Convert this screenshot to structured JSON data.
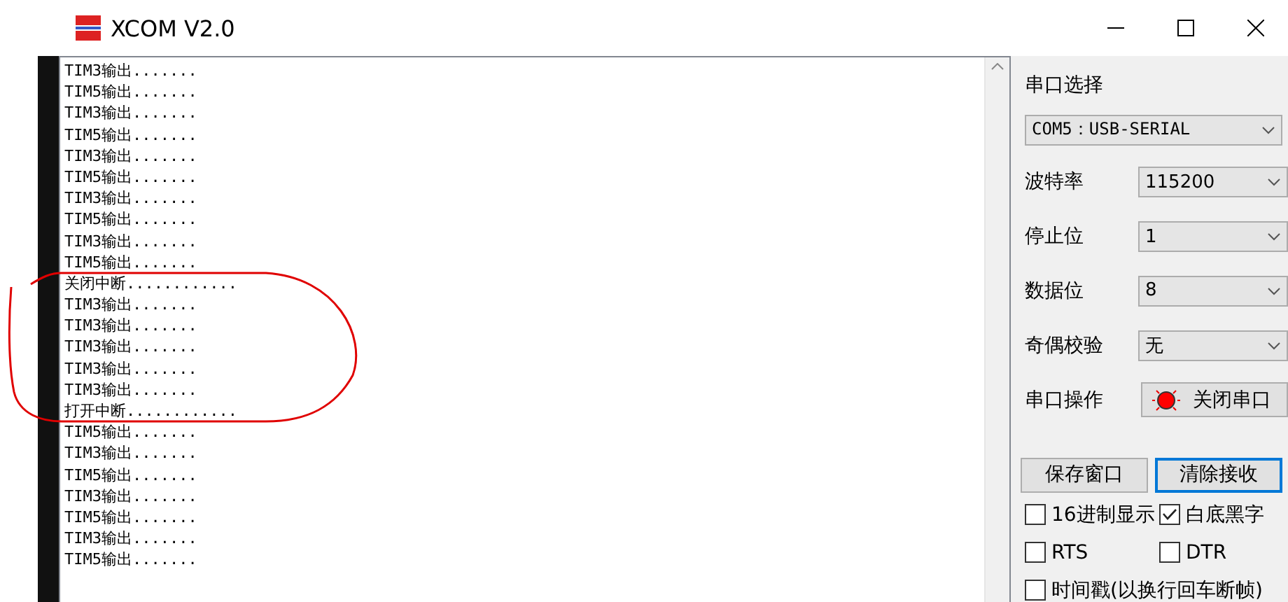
{
  "window": {
    "title": "XCOM V2.0"
  },
  "log_lines": [
    "TIM3输出.......",
    "TIM5输出.......",
    "TIM3输出.......",
    "TIM5输出.......",
    "TIM3输出.......",
    "TIM5输出.......",
    "TIM3输出.......",
    "TIM5输出.......",
    "TIM3输出.......",
    "TIM5输出.......",
    "关闭中断............",
    "TIM3输出.......",
    "TIM3输出.......",
    "TIM3输出.......",
    "TIM3输出.......",
    "TIM3输出.......",
    "打开中断............",
    "TIM5输出.......",
    "TIM3输出.......",
    "TIM5输出.......",
    "TIM3输出.......",
    "TIM5输出.......",
    "TIM3输出.......",
    "TIM5输出......."
  ],
  "port_select": {
    "label": "串口选择",
    "value": "COM5：USB-SERIAL"
  },
  "settings": [
    {
      "label": "波特率",
      "value": "115200"
    },
    {
      "label": "停止位",
      "value": "1"
    },
    {
      "label": "数据位",
      "value": "8"
    },
    {
      "label": "奇偶校验",
      "value": "无"
    }
  ],
  "port_operation": {
    "label": "串口操作",
    "button": "关闭串口",
    "open": true
  },
  "buttons": [
    {
      "label": "保存窗口",
      "focused": false
    },
    {
      "label": "清除接收",
      "focused": true
    }
  ],
  "checkboxes": [
    {
      "label": "16进制显示",
      "checked": false
    },
    {
      "label": "白底黑字",
      "checked": true
    },
    {
      "label": "RTS",
      "checked": false
    },
    {
      "label": "DTR",
      "checked": false
    },
    {
      "label": "时间戳(以换行回车断帧)",
      "checked": false
    }
  ]
}
